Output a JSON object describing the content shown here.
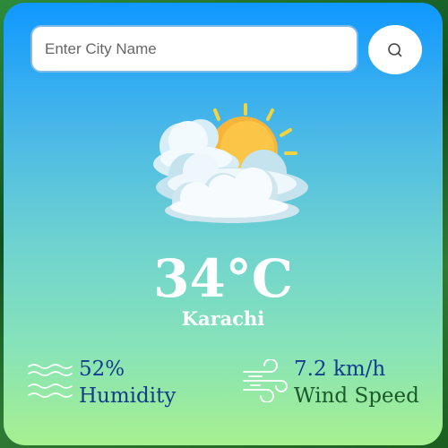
{
  "search": {
    "placeholder": "Enter City Name",
    "value": ""
  },
  "weather": {
    "icon": "partly-cloudy-sun-icon",
    "temperature": "34°C",
    "city": "Karachi"
  },
  "stats": {
    "humidity": {
      "icon": "waves-icon",
      "value": "52%",
      "label": "Humidity"
    },
    "wind": {
      "icon": "wind-icon",
      "value": "7.2 km/h",
      "label": "Wind Speed"
    }
  },
  "colors": {
    "card_top": "#0f98ff",
    "card_bottom": "#a6f08f",
    "stat_text": "#123c8c"
  }
}
